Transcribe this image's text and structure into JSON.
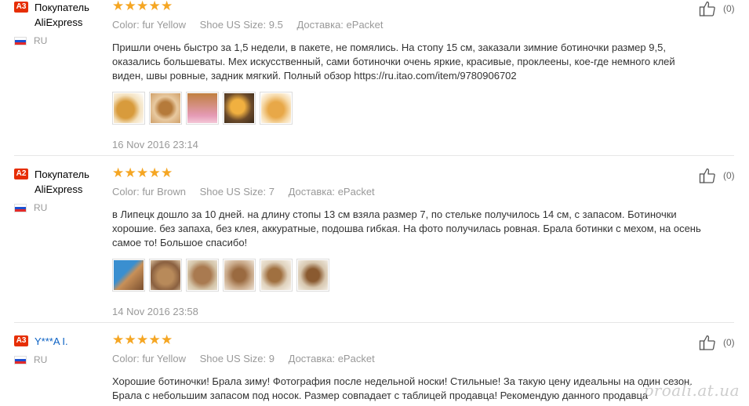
{
  "reviews": [
    {
      "level": "A3",
      "buyer": [
        "Покупатель",
        "AliExpress"
      ],
      "country": "RU",
      "attrs": {
        "color_label": "Color:",
        "color": "fur Yellow",
        "size_label": "Shoe US Size:",
        "size": "9.5",
        "ship_label": "Доставка:",
        "ship": "ePacket"
      },
      "text": "Пришли очень быстро за 1,5 недели, в пакете, не помялись. На стопу 15 см, заказали зимние ботиночки размер 9,5, оказались большеваты. Мех искусственный, сами ботиночки очень яркие, красивые, проклеены, кое-где немного клей виден, швы ровные, задник мягкий. Полный обзор https://ru.itao.com/item/9780906702",
      "photos": 5,
      "date": "16 Nov 2016 23:14",
      "likes": "(0)"
    },
    {
      "level": "A2",
      "buyer": [
        "Покупатель",
        "AliExpress"
      ],
      "country": "RU",
      "attrs": {
        "color_label": "Color:",
        "color": "fur Brown",
        "size_label": "Shoe US Size:",
        "size": "7",
        "ship_label": "Доставка:",
        "ship": "ePacket"
      },
      "text": "в Липецк дошло за 10 дней. на длину стопы 13 см взяла размер 7, по стельке получилось 14 см, с запасом. Ботиночки хорошие. без запаха, без клея, аккуратные, подошва гибкая. На фото получилась ровная. Брала ботинки с мехом, на осень самое то! Большое спасибо!",
      "photos": 6,
      "date": "14 Nov 2016 23:58",
      "likes": "(0)"
    },
    {
      "level": "A3",
      "buyer": [
        "Y***A I."
      ],
      "country": "RU",
      "attrs": {
        "color_label": "Color:",
        "color": "fur Yellow",
        "size_label": "Shoe US Size:",
        "size": "9",
        "ship_label": "Доставка:",
        "ship": "ePacket"
      },
      "text": "Хорошие ботиночки! Брала зиму! Фотография после недельной носки! Стильные! За такую цену идеальны на один сезон. Брала с небольшим запасом под носок. Размер совпадает с таблицей продавца! Рекомендую данного продавца",
      "likes": "(0)"
    }
  ],
  "watermark": "proali.at.ua",
  "colors": {
    "star": "#f5a623",
    "badge": "#e62e04",
    "link": "#0b61c4"
  }
}
